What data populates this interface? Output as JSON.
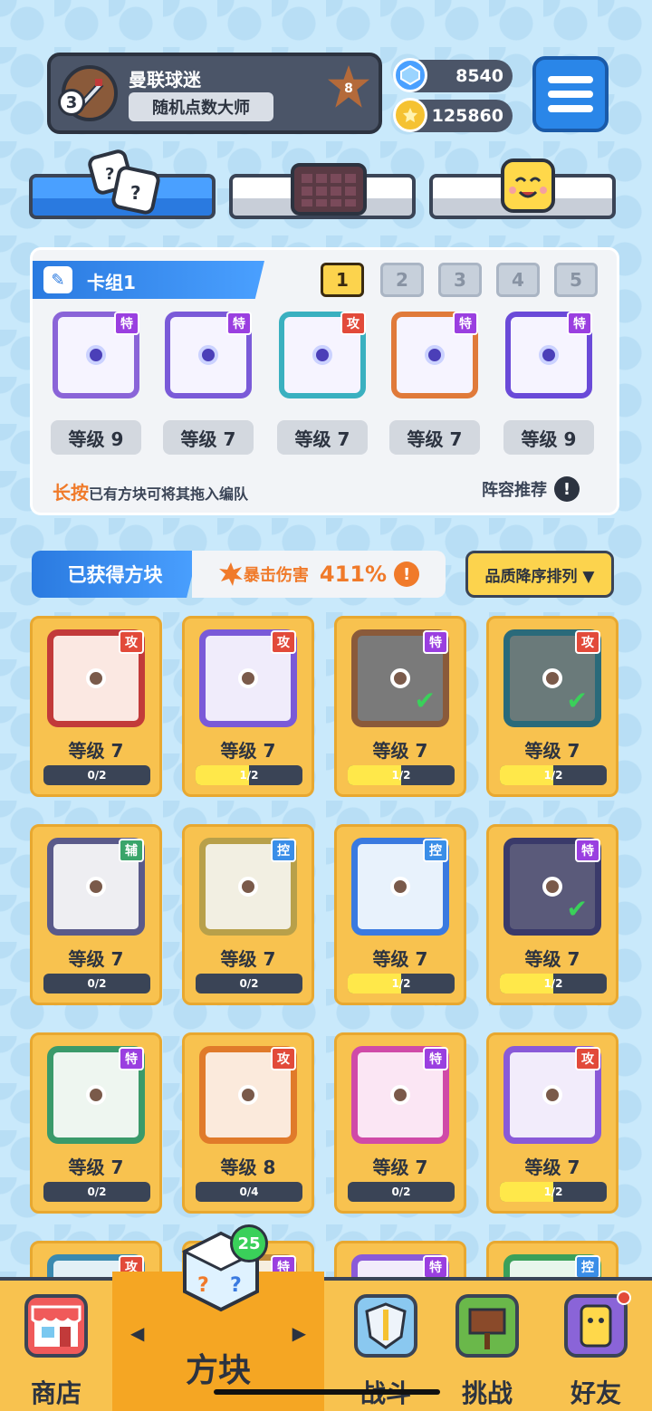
{
  "profile": {
    "name": "曼联球迷",
    "title": "随机点数大师",
    "level": "3",
    "rank": "8"
  },
  "resources": {
    "gems": "8540",
    "coins": "125860"
  },
  "deck": {
    "name": "卡组1",
    "slots": [
      "1",
      "2",
      "3",
      "4",
      "5"
    ],
    "active_slot": "1",
    "cards": [
      {
        "tag": "特",
        "tag_type": "te",
        "level": "等级 9",
        "color": "#8a64d8"
      },
      {
        "tag": "特",
        "tag_type": "te",
        "level": "等级 7",
        "color": "#7a5ad8"
      },
      {
        "tag": "攻",
        "tag_type": "gong",
        "level": "等级 7",
        "color": "#3ab0c0"
      },
      {
        "tag": "特",
        "tag_type": "te",
        "level": "等级 7",
        "color": "#e07a3a"
      },
      {
        "tag": "特",
        "tag_type": "te",
        "level": "等级 9",
        "color": "#6a4ad8"
      }
    ],
    "hint_em": "长按",
    "hint_text": "已有方块可将其拖入编队",
    "recommend": "阵容推荐",
    "recommend_icon": "!"
  },
  "obtained": {
    "title": "已获得方块",
    "crit_label": "暴击伤害",
    "crit_value": "411%",
    "crit_icon": "!",
    "sort_label": "品质降序排列 ▼"
  },
  "grid": [
    {
      "tag": "攻",
      "tag_type": "gong",
      "level": "等级 7",
      "progress": "0/2",
      "fill": 0,
      "color": "#c23a3a",
      "bg": "#fbe8e2",
      "check": false
    },
    {
      "tag": "攻",
      "tag_type": "gong",
      "level": "等级 7",
      "progress": "1/2",
      "fill": 0.5,
      "color": "#7a5ad8",
      "bg": "#f0ecfb",
      "check": false
    },
    {
      "tag": "特",
      "tag_type": "te",
      "level": "等级 7",
      "progress": "1/2",
      "fill": 0.5,
      "color": "#8a5a3a",
      "bg": "#7a7a7a",
      "check": true
    },
    {
      "tag": "攻",
      "tag_type": "gong",
      "level": "等级 7",
      "progress": "1/2",
      "fill": 0.5,
      "color": "#2a6a7a",
      "bg": "#6a7a7a",
      "check": true
    },
    {
      "tag": "辅",
      "tag_type": "fu",
      "level": "等级 7",
      "progress": "0/2",
      "fill": 0,
      "color": "#5a5a8a",
      "bg": "#eeeef2",
      "check": false
    },
    {
      "tag": "控",
      "tag_type": "kong",
      "level": "等级 7",
      "progress": "0/2",
      "fill": 0,
      "color": "#b8a04a",
      "bg": "#f2efe2",
      "check": false
    },
    {
      "tag": "控",
      "tag_type": "kong",
      "level": "等级 7",
      "progress": "1/2",
      "fill": 0.5,
      "color": "#3a7ae0",
      "bg": "#e8f2fc",
      "check": false
    },
    {
      "tag": "特",
      "tag_type": "te",
      "level": "等级 7",
      "progress": "1/2",
      "fill": 0.5,
      "color": "#3a3a6a",
      "bg": "#5a5a7a",
      "check": true
    },
    {
      "tag": "特",
      "tag_type": "te",
      "level": "等级 7",
      "progress": "0/2",
      "fill": 0,
      "color": "#3a9a6a",
      "bg": "#eef6f0",
      "check": false
    },
    {
      "tag": "攻",
      "tag_type": "gong",
      "level": "等级 8",
      "progress": "0/4",
      "fill": 0,
      "color": "#e07a2a",
      "bg": "#fbeadc",
      "check": false
    },
    {
      "tag": "特",
      "tag_type": "te",
      "level": "等级 7",
      "progress": "0/2",
      "fill": 0,
      "color": "#d04aa8",
      "bg": "#fbe6f4",
      "check": false
    },
    {
      "tag": "攻",
      "tag_type": "gong",
      "level": "等级 7",
      "progress": "1/2",
      "fill": 0.5,
      "color": "#8a5ad8",
      "bg": "#f2ecfb",
      "check": false
    },
    {
      "tag": "攻",
      "tag_type": "gong",
      "color": "#3a8ab0",
      "bg": "#e2f0f6"
    },
    {
      "tag": "特",
      "tag_type": "te",
      "color": "#c08a3a",
      "bg": "#f6eee0"
    },
    {
      "tag": "特",
      "tag_type": "te",
      "color": "#8a5ad8",
      "bg": "#f2ecfb"
    },
    {
      "tag": "控",
      "tag_type": "kong",
      "color": "#3aa05a",
      "bg": "#e8f6ec"
    }
  ],
  "nav": {
    "shop": "商店",
    "blocks": "方块",
    "battle": "战斗",
    "challenge": "挑战",
    "friends": "好友",
    "blocks_badge": "25",
    "prev": "◀",
    "next": "▶"
  }
}
